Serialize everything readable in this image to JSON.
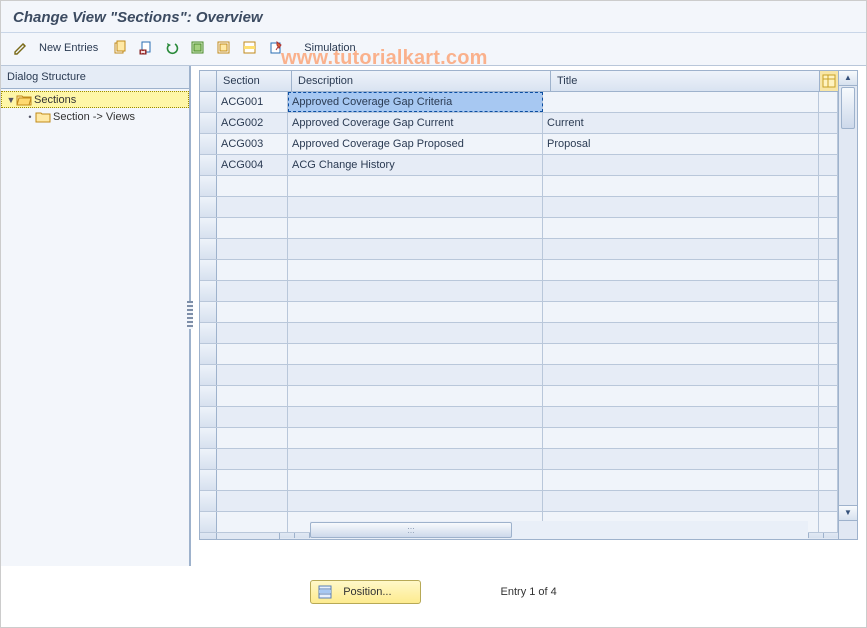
{
  "page_title": "Change View \"Sections\": Overview",
  "watermark": "www.tutorialkart.com",
  "toolbar": {
    "new_entries": "New Entries",
    "simulation": "Simulation"
  },
  "tree": {
    "header": "Dialog Structure",
    "items": [
      {
        "label": "Sections",
        "icon": "folder-open",
        "selected": true
      },
      {
        "label": "Section -> Views",
        "icon": "folder",
        "selected": false
      }
    ]
  },
  "table": {
    "columns": {
      "section": "Section",
      "description": "Description",
      "title": "Title"
    },
    "rows": [
      {
        "section": "ACG001",
        "description": "Approved Coverage Gap Criteria",
        "title": ""
      },
      {
        "section": "ACG002",
        "description": "Approved Coverage Gap Current",
        "title": "Current"
      },
      {
        "section": "ACG003",
        "description": "Approved Coverage Gap Proposed",
        "title": "Proposal"
      },
      {
        "section": "ACG004",
        "description": "ACG Change History",
        "title": ""
      }
    ],
    "selected_row": 0,
    "selected_col": "description"
  },
  "footer": {
    "position_button": "Position...",
    "entry_text": "Entry 1 of 4"
  },
  "chart_data": {
    "type": "table",
    "title": "Sections",
    "columns": [
      "Section",
      "Description",
      "Title"
    ],
    "rows": [
      [
        "ACG001",
        "Approved Coverage Gap Criteria",
        ""
      ],
      [
        "ACG002",
        "Approved Coverage Gap Current",
        "Current"
      ],
      [
        "ACG003",
        "Approved Coverage Gap Proposed",
        "Proposal"
      ],
      [
        "ACG004",
        "ACG Change History",
        ""
      ]
    ]
  }
}
